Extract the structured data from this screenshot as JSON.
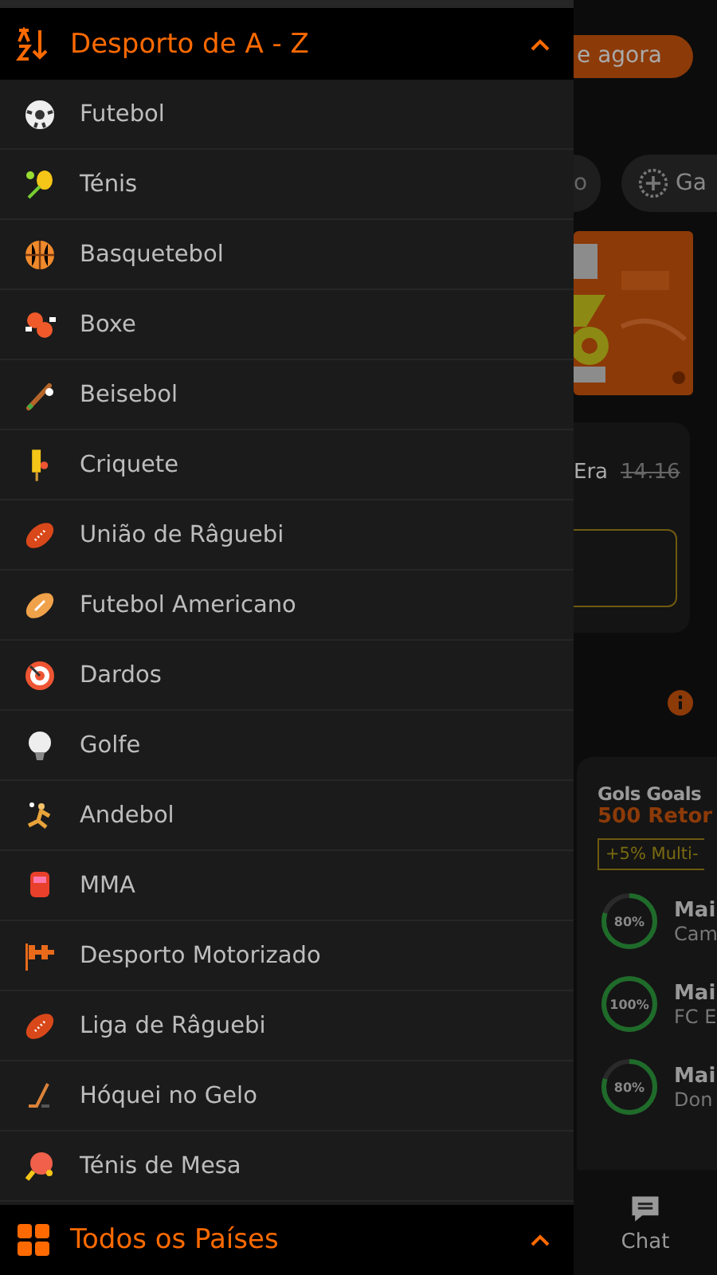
{
  "drawer": {
    "title": "Desporto de A - Z",
    "sports": [
      {
        "name": "Futebol",
        "kind": "soccer"
      },
      {
        "name": "Ténis",
        "kind": "tennis"
      },
      {
        "name": "Basquetebol",
        "kind": "basketball"
      },
      {
        "name": "Boxe",
        "kind": "boxing"
      },
      {
        "name": "Beisebol",
        "kind": "baseball"
      },
      {
        "name": "Criquete",
        "kind": "cricket"
      },
      {
        "name": "União de Râguebi",
        "kind": "rugby"
      },
      {
        "name": "Futebol Americano",
        "kind": "football"
      },
      {
        "name": "Dardos",
        "kind": "darts"
      },
      {
        "name": "Golfe",
        "kind": "golf"
      },
      {
        "name": "Andebol",
        "kind": "handball"
      },
      {
        "name": "MMA",
        "kind": "mma"
      },
      {
        "name": "Desporto Motorizado",
        "kind": "motor"
      },
      {
        "name": "Liga de Râguebi",
        "kind": "rugby"
      },
      {
        "name": "Hóquei no Gelo",
        "kind": "hockey"
      },
      {
        "name": "Ténis de Mesa",
        "kind": "pingpong"
      }
    ],
    "footer_title": "Todos os Países"
  },
  "background": {
    "cta_button": "e agora",
    "chips": [
      {
        "label": "o",
        "kind": "plain"
      },
      {
        "label": "Ga",
        "kind": "icon"
      }
    ],
    "odds_card": {
      "label": "Era",
      "old_odds": "14.16"
    },
    "bet_card": {
      "title": "Gols Goals",
      "subtitle": "500 Retor",
      "boost": "+5% Multi-",
      "picks": [
        {
          "percent": "80%",
          "level": 0.8,
          "title": "Mai",
          "subtitle": "Cam"
        },
        {
          "percent": "100%",
          "level": 1,
          "title": "Mai",
          "subtitle": "FC E"
        },
        {
          "percent": "80%",
          "level": 0.8,
          "title": "Mai",
          "subtitle": "Don"
        }
      ]
    },
    "nav": {
      "chat": "Chat"
    }
  }
}
